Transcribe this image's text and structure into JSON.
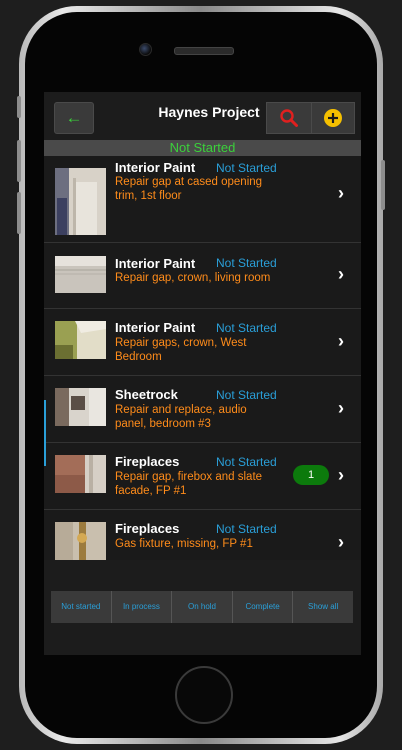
{
  "header": {
    "title": "Haynes Project",
    "back_icon": "←"
  },
  "status_filter": "Not Started",
  "items": [
    {
      "category": "Interior Paint",
      "status": "Not Started",
      "description": "Repair gap at cased opening trim, 1st floor",
      "badge": ""
    },
    {
      "category": "Interior Paint",
      "status": "Not Started",
      "description": "Repair gap, crown, living room",
      "badge": ""
    },
    {
      "category": "Interior Paint",
      "status": "Not Started",
      "description": "Repair gaps, crown, West Bedroom",
      "badge": ""
    },
    {
      "category": "Sheetrock",
      "status": "Not Started",
      "description": "Repair and replace, audio panel, bedroom #3",
      "badge": ""
    },
    {
      "category": "Fireplaces",
      "status": "Not Started",
      "description": "Repair gap, firebox and slate facade, FP #1",
      "badge": "1"
    },
    {
      "category": "Fireplaces",
      "status": "Not Started",
      "description": "Gas fixture, missing, FP #1",
      "badge": ""
    }
  ],
  "filters": [
    "Not started",
    "In process",
    "On hold",
    "Complete",
    "Show all"
  ],
  "colors": {
    "accent_green": "#3bd13b",
    "status_blue": "#2a9fd8",
    "desc_orange": "#ff8c1a",
    "badge_green": "#0c7a0c"
  }
}
